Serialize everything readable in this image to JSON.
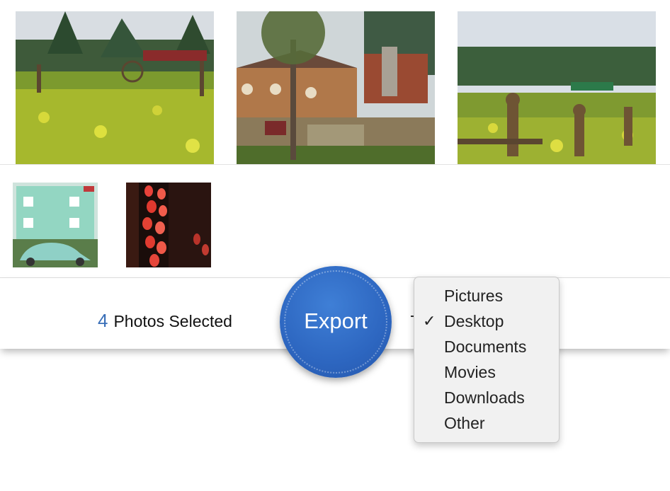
{
  "photos_row_top": [
    {
      "name": "photo-canola-field-scarecrows"
    },
    {
      "name": "photo-village-tree-stairs"
    },
    {
      "name": "photo-scarecrow-garden"
    }
  ],
  "photos_row_bottom": [
    {
      "name": "photo-mint-house-beetle"
    },
    {
      "name": "photo-red-lanterns-night"
    }
  ],
  "status": {
    "count": "4",
    "label": "Photos Selected"
  },
  "export": {
    "label": "Export",
    "color": "#2d66c0"
  },
  "destination_menu": {
    "items": [
      "Pictures",
      "Desktop",
      "Documents",
      "Movies",
      "Downloads",
      "Other"
    ],
    "selected": "Desktop",
    "check_glyph": "✓"
  }
}
